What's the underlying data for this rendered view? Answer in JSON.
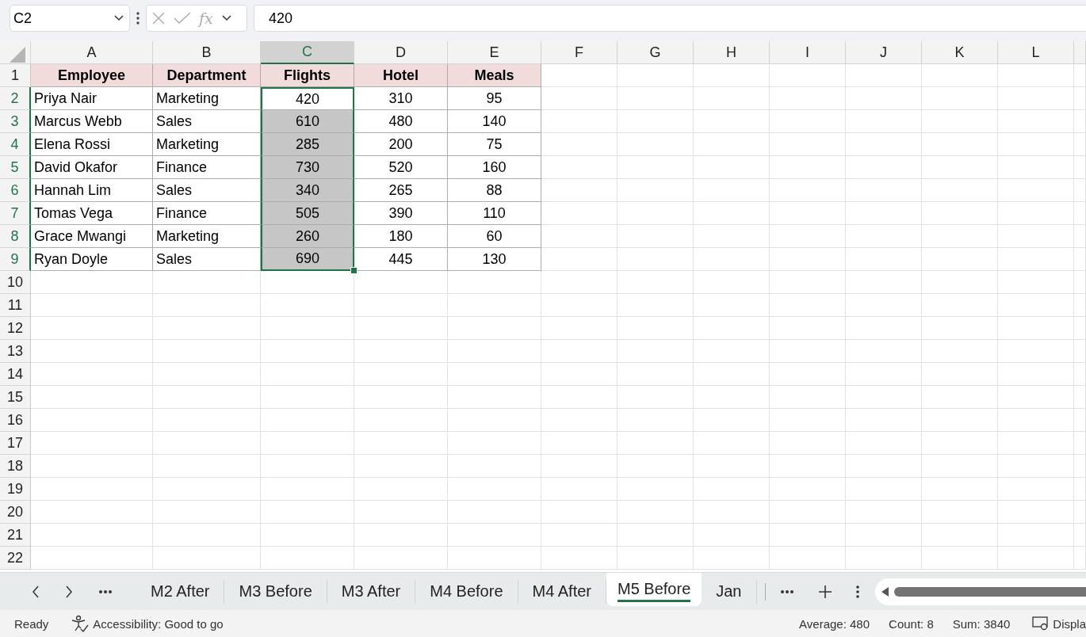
{
  "formula_bar": {
    "name_box": "C2",
    "function_label": "fx",
    "value": "420"
  },
  "sheet": {
    "columns": [
      {
        "label": "A",
        "selected": false
      },
      {
        "label": "B",
        "selected": false
      },
      {
        "label": "C",
        "selected": true
      },
      {
        "label": "D",
        "selected": false
      },
      {
        "label": "E",
        "selected": false
      },
      {
        "label": "F",
        "selected": false
      },
      {
        "label": "G",
        "selected": false
      },
      {
        "label": "H",
        "selected": false
      },
      {
        "label": "I",
        "selected": false
      },
      {
        "label": "J",
        "selected": false
      },
      {
        "label": "K",
        "selected": false
      },
      {
        "label": "L",
        "selected": false
      }
    ],
    "rows": [
      {
        "number": "1",
        "kind": "header",
        "selected": false,
        "active": false,
        "cells": [
          "Employee",
          "Department",
          "Flights",
          "Hotel",
          "Meals"
        ]
      },
      {
        "number": "2",
        "kind": "data",
        "selected": true,
        "active": true,
        "cells": [
          "Priya Nair",
          "Marketing",
          "420",
          "310",
          "95"
        ]
      },
      {
        "number": "3",
        "kind": "data",
        "selected": true,
        "active": false,
        "cells": [
          "Marcus Webb",
          "Sales",
          "610",
          "480",
          "140"
        ]
      },
      {
        "number": "4",
        "kind": "data",
        "selected": true,
        "active": false,
        "cells": [
          "Elena Rossi",
          "Marketing",
          "285",
          "200",
          "75"
        ]
      },
      {
        "number": "5",
        "kind": "data",
        "selected": true,
        "active": false,
        "cells": [
          "David Okafor",
          "Finance",
          "730",
          "520",
          "160"
        ]
      },
      {
        "number": "6",
        "kind": "data",
        "selected": true,
        "active": false,
        "cells": [
          "Hannah Lim",
          "Sales",
          "340",
          "265",
          "88"
        ]
      },
      {
        "number": "7",
        "kind": "data",
        "selected": true,
        "active": false,
        "cells": [
          "Tomas Vega",
          "Finance",
          "505",
          "390",
          "110"
        ]
      },
      {
        "number": "8",
        "kind": "data",
        "selected": true,
        "active": false,
        "cells": [
          "Grace Mwangi",
          "Marketing",
          "260",
          "180",
          "60"
        ]
      },
      {
        "number": "9",
        "kind": "data",
        "selected": true,
        "active": false,
        "cells": [
          "Ryan Doyle",
          "Sales",
          "690",
          "445",
          "130"
        ]
      },
      {
        "number": "10",
        "selected": false,
        "active": false
      },
      {
        "number": "11",
        "selected": false,
        "active": false
      },
      {
        "number": "12",
        "selected": false,
        "active": false
      },
      {
        "number": "13",
        "selected": false,
        "active": false
      },
      {
        "number": "14",
        "selected": false,
        "active": false
      },
      {
        "number": "15",
        "selected": false,
        "active": false
      },
      {
        "number": "16",
        "selected": false,
        "active": false
      },
      {
        "number": "17",
        "selected": false,
        "active": false
      },
      {
        "number": "18",
        "selected": false,
        "active": false
      },
      {
        "number": "19",
        "selected": false,
        "active": false
      },
      {
        "number": "20",
        "selected": false,
        "active": false
      },
      {
        "number": "21",
        "selected": false,
        "active": false
      },
      {
        "number": "22",
        "selected": false,
        "active": false
      }
    ]
  },
  "sheet_tabs": [
    {
      "label": "M2 After",
      "selected": false
    },
    {
      "label": "M3 Before",
      "selected": false
    },
    {
      "label": "M3 After",
      "selected": false
    },
    {
      "label": "M4 Before",
      "selected": false
    },
    {
      "label": "M4 After",
      "selected": false
    },
    {
      "label": "M5 Before",
      "selected": true
    },
    {
      "label": "Jan",
      "selected": false
    }
  ],
  "status_bar": {
    "mode": "Ready",
    "accessibility": "Accessibility: Good to go",
    "average": "Average: 480",
    "count": "Count: 8",
    "sum": "Sum: 3840",
    "display": "Displa"
  }
}
